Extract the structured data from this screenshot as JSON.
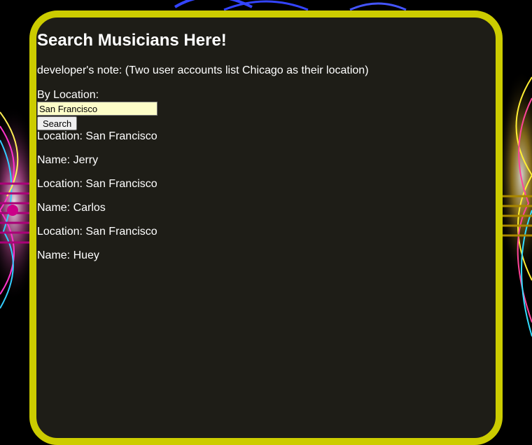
{
  "page": {
    "title": "Search Musicians Here!",
    "note": "developer's note: (Two user accounts list Chicago as their location)"
  },
  "search": {
    "label": "By Location:",
    "value": "San Francisco",
    "button_label": "Search"
  },
  "results": [
    {
      "location": "Location: San Francisco",
      "name": "Name: Jerry"
    },
    {
      "location": "Location: San Francisco",
      "name": "Name: Carlos"
    },
    {
      "location": "Location: San Francisco",
      "name": "Name: Huey"
    }
  ],
  "colors": {
    "panel_background": "#1e1d17",
    "panel_border": "#cccc00",
    "text": "#ffffff",
    "input_background": "#fdfdc8"
  }
}
